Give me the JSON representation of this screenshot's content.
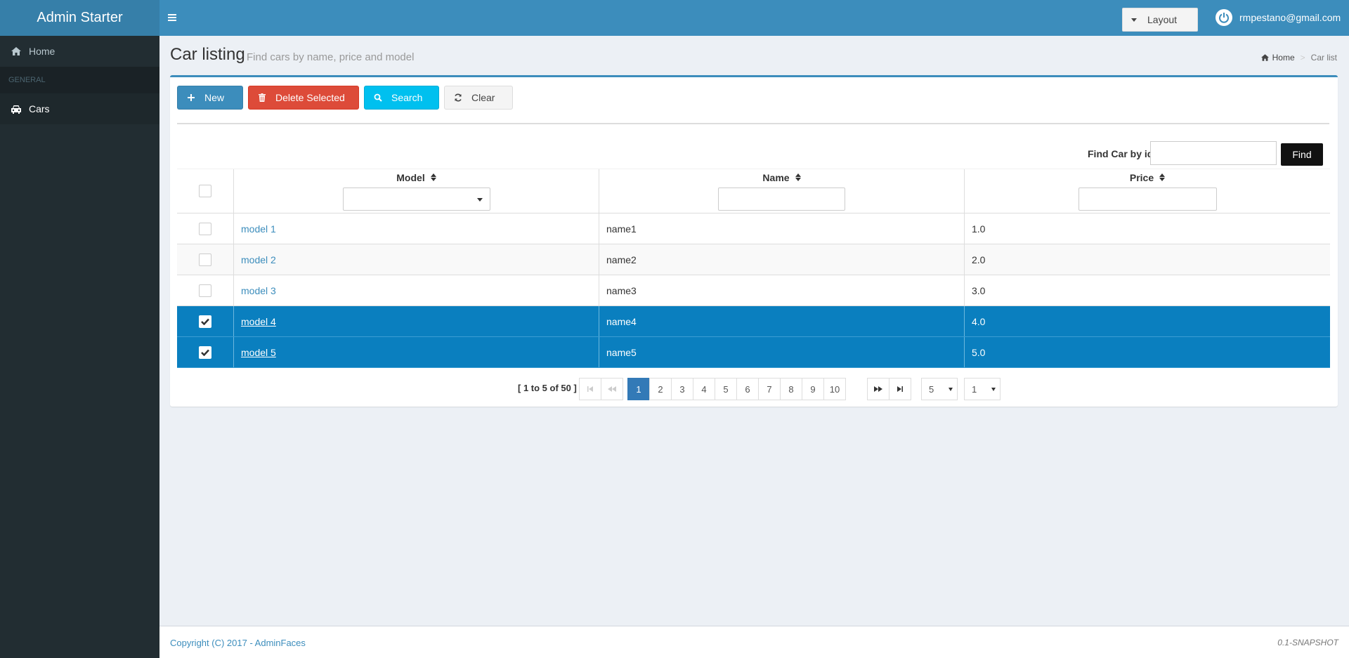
{
  "app": {
    "logo": "Admin Starter"
  },
  "sidebar": {
    "home_label": "Home",
    "section_header": "GENERAL",
    "items": [
      {
        "label": "Cars",
        "icon": "car-icon"
      }
    ]
  },
  "topbar": {
    "layout_label": "Layout",
    "user_email": "rmpestano@gmail.com"
  },
  "page": {
    "title": "Car listing",
    "subtitle": "Find cars by name, price and model",
    "breadcrumb": {
      "home": "Home",
      "current": "Car list"
    }
  },
  "toolbar": {
    "new_label": "New",
    "delete_label": "Delete Selected",
    "search_label": "Search",
    "clear_label": "Clear"
  },
  "find": {
    "label": "Find Car by id:",
    "button": "Find",
    "value": ""
  },
  "table": {
    "columns": {
      "model": "Model",
      "name": "Name",
      "price": "Price"
    },
    "rows": [
      {
        "model": "model 1",
        "name": "name1",
        "price": "1.0",
        "selected": false
      },
      {
        "model": "model 2",
        "name": "name2",
        "price": "2.0",
        "selected": false
      },
      {
        "model": "model 3",
        "name": "name3",
        "price": "3.0",
        "selected": false
      },
      {
        "model": "model 4",
        "name": "name4",
        "price": "4.0",
        "selected": true
      },
      {
        "model": "model 5",
        "name": "name5",
        "price": "5.0",
        "selected": true
      }
    ]
  },
  "paginator": {
    "summary": "[ 1 to 5 of 50 ]",
    "pages": [
      "1",
      "2",
      "3",
      "4",
      "5",
      "6",
      "7",
      "8",
      "9",
      "10"
    ],
    "current_page": "1",
    "rows_per_page": "5",
    "jump_page": "1"
  },
  "footer": {
    "copyright": "Copyright (C) 2017 - AdminFaces",
    "version": "0.1-SNAPSHOT"
  },
  "colors": {
    "header": "#3c8dbc",
    "sidebar": "#222d32",
    "selected_row": "#0a7fbf",
    "danger": "#dd4b39",
    "info": "#00c0ef"
  }
}
